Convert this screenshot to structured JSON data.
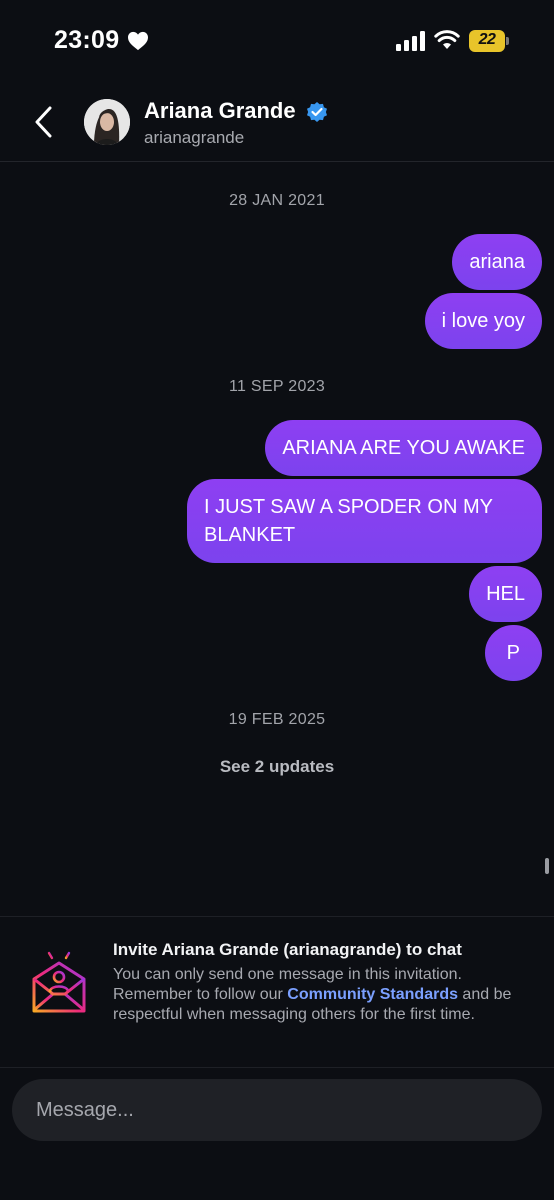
{
  "status_bar": {
    "time": "23:09",
    "battery_level": "22",
    "icons": [
      "heart-icon",
      "signal-icon",
      "wifi-icon",
      "battery-icon"
    ]
  },
  "header": {
    "name": "Ariana Grande",
    "username": "arianagrande",
    "verified": true,
    "accent": "#3897f0"
  },
  "conversation": {
    "groups": [
      {
        "date": "28 JAN 2021",
        "messages": [
          "ariana",
          "i love yoy"
        ]
      },
      {
        "date": "11 SEP 2023",
        "messages": [
          "ARIANA ARE YOU AWAKE",
          "I JUST SAW A SPODER ON MY BLANKET",
          "HEL",
          "P"
        ]
      },
      {
        "date": "19 FEB 2025",
        "messages": []
      }
    ],
    "see_updates": "See 2 updates",
    "bubble_color": "#8a3ff1"
  },
  "invite": {
    "title": "Invite Ariana Grande (arianagrande) to chat",
    "body_before": "You can only send one message in this invitation. Remember to follow our ",
    "link": "Community Standards",
    "body_after": " and be respectful when messaging others for the first time.",
    "link_color": "#7ba0ff"
  },
  "composer": {
    "placeholder": "Message..."
  }
}
